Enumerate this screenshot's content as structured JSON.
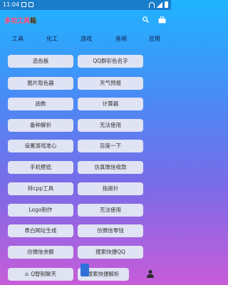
{
  "status": {
    "time": "11:04"
  },
  "app": {
    "title_a": "多功工具",
    "title_b": "箱"
  },
  "tabs": [
    "工具",
    "化工",
    "游戏",
    "音频",
    "应用"
  ],
  "buttons": [
    "选色板",
    "QQ群彩色名字",
    "图片取色器",
    "天气预报",
    "函数",
    "计算器",
    "备种解析",
    "无法使用",
    "设置游戏准心",
    "百度一下",
    "手机壁纸",
    "仿真微信收款",
    "转cpp工具",
    "指南针",
    "Logo制作",
    "无法使用",
    "表白网址生成",
    "仿微信零钱",
    "仿微信余额",
    "搜索快捷QQ"
  ],
  "bottom": {
    "left_label": "Q智制聊天",
    "right_label": "搜索快捷解析"
  },
  "icons": {
    "search": "search-icon",
    "tool": "toolbox-icon",
    "user": "person-icon"
  }
}
